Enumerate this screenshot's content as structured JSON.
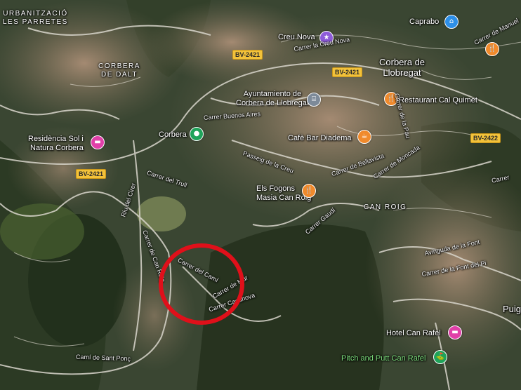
{
  "map": {
    "areas": {
      "urbanitzacio": "URBANITZACIÓ\nLES PARRETES",
      "corbera_dalt": "CORBERA\nDE DALT",
      "can_roig": "CAN ROIG"
    },
    "towns": {
      "corbera_llobregat": "Corbera de\nLlobregat",
      "puig_partial": "Puig"
    },
    "pois": {
      "creu_nova": "Creu Nova",
      "caprabo": "Caprabo",
      "ayuntamiento": "Ayuntamiento de\nCorbera de Llobregat",
      "restaurant_cal_quimet": "Restaurant Cal Quimet",
      "cafe_bar_diadema": "Cafè Bar Diadema",
      "residencia": "Residència Sol i\nNatura Corbera",
      "corbera": "Corbera",
      "els_fogons": "Els Fogons\nMasia Can Roig",
      "hotel_can_rafel": "Hotel Can Rafel",
      "pitch_and_putt": "Pitch and Putt Can Rafel"
    },
    "streets": {
      "carrer_creu": "Carrer la Creu Nova",
      "buenos_aires": "Carrer Buenos Aires",
      "de_la_pau": "Carrer de la Pau",
      "del_trull": "Carrer del Trull",
      "passeig": "Passeig de la Creu",
      "bellavista": "Carrer de Bellavista",
      "de_moncada": "Carrer de Moncada",
      "riu_del_cirer": "Riu del Cirer",
      "can_roig_street": "Carrer de Can Roig",
      "gaudi": "Carrer Gaudí",
      "avinguda_font": "Avinguda de la Font",
      "carrer_font_del_pi": "Carrer de la Font del Pi",
      "cami_sant_ponc": "Camí de Sant Ponç",
      "carrer_casanova": "Carrer Casanova",
      "carrer_mallorca_partial": "Carrer",
      "carrer_manuel_partial": "Carrer de Manuel",
      "carrer_del_cami": "Carrer del Camí",
      "carrer_de_mur": "Carrer de Mur"
    },
    "roads": {
      "bv2421_a": "BV-2421",
      "bv2421_b": "BV-2421",
      "bv2421_c": "BV-2421",
      "bv2422": "BV-2422"
    },
    "icons": {
      "purple": "#8e5bd9",
      "blue": "#2d8fe8",
      "orange": "#f08a2c",
      "gray": "#7d8a99",
      "pink": "#e040a8",
      "green": "#1fa35a",
      "highlight": "#e0101a"
    }
  }
}
